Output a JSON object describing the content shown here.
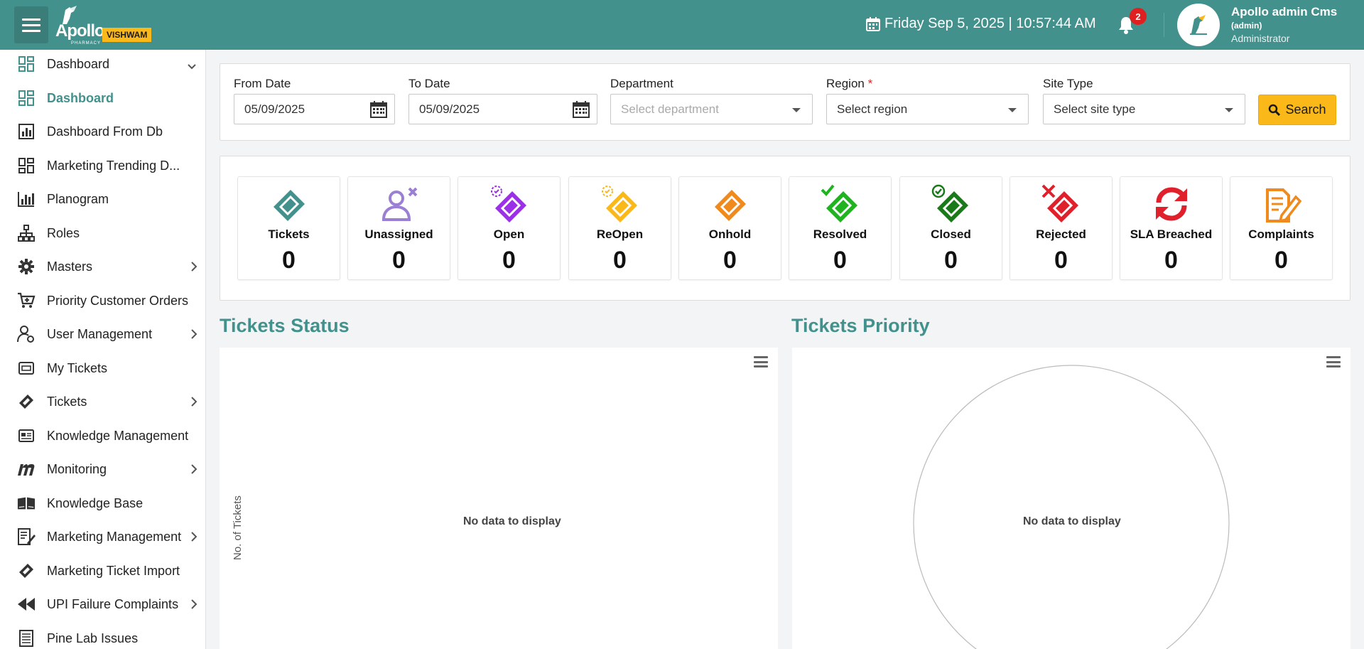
{
  "header": {
    "brand": "Apollo",
    "brand_sub": "PHARMACY",
    "badge": "VISHWAM",
    "datetime": "Friday Sep 5, 2025 | 10:57:44  AM",
    "notification_count": "2",
    "user": {
      "name": "Apollo admin Cms",
      "handle": "(admin)",
      "role": "Administrator"
    }
  },
  "sidebar": {
    "items": [
      {
        "label": "Dashboard",
        "icon": "grid-icon",
        "expand": "down"
      },
      {
        "label": "Dashboard",
        "icon": "grid-icon",
        "active": true
      },
      {
        "label": "Dashboard From Db",
        "icon": "bar-chart-icon"
      },
      {
        "label": "Marketing Trending D...",
        "icon": "grid-icon"
      },
      {
        "label": "Planogram",
        "icon": "analytics-icon"
      },
      {
        "label": "Roles",
        "icon": "hierarchy-icon"
      },
      {
        "label": "Masters",
        "icon": "gear-icon",
        "expand": "right"
      },
      {
        "label": "Priority Customer Orders",
        "icon": "cart-icon"
      },
      {
        "label": "User Management",
        "icon": "user-gear-icon",
        "expand": "right"
      },
      {
        "label": "My Tickets",
        "icon": "ticket-box-icon"
      },
      {
        "label": "Tickets",
        "icon": "ticket-icon",
        "expand": "right"
      },
      {
        "label": "Knowledge Management",
        "icon": "newspaper-icon"
      },
      {
        "label": "Monitoring",
        "icon": "m-logo-icon",
        "expand": "right"
      },
      {
        "label": "Knowledge Base",
        "icon": "book-icon"
      },
      {
        "label": "Marketing Management",
        "icon": "edit-doc-icon",
        "expand": "right"
      },
      {
        "label": "Marketing Ticket Import",
        "icon": "ticket-icon"
      },
      {
        "label": "UPI Failure Complaints",
        "icon": "rewind-icon",
        "expand": "right"
      },
      {
        "label": "Pine Lab Issues",
        "icon": "list-doc-icon"
      }
    ]
  },
  "filters": {
    "from_date": {
      "label": "From Date",
      "value": "05/09/2025"
    },
    "to_date": {
      "label": "To Date",
      "value": "05/09/2025"
    },
    "department": {
      "label": "Department",
      "placeholder": "Select department"
    },
    "region": {
      "label": "Region",
      "required_mark": "*",
      "value": "Select region"
    },
    "site_type": {
      "label": "Site Type",
      "value": "Select site type"
    },
    "search_label": "Search"
  },
  "stats": [
    {
      "label": "Tickets",
      "value": "0",
      "color": "#43918c",
      "icon": "ticket-icon"
    },
    {
      "label": "Unassigned",
      "value": "0",
      "color": "#9b7fd4",
      "icon": "user-x-icon"
    },
    {
      "label": "Open",
      "value": "0",
      "color": "#9b30e8",
      "icon": "ticket-open-icon"
    },
    {
      "label": "ReOpen",
      "value": "0",
      "color": "#fbb819",
      "icon": "ticket-reopen-icon"
    },
    {
      "label": "Onhold",
      "value": "0",
      "color": "#f08a1c",
      "icon": "ticket-hold-icon"
    },
    {
      "label": "Resolved",
      "value": "0",
      "color": "#1fb31f",
      "icon": "ticket-check-icon"
    },
    {
      "label": "Closed",
      "value": "0",
      "color": "#1a7a1a",
      "icon": "ticket-closed-icon"
    },
    {
      "label": "Rejected",
      "value": "0",
      "color": "#e0202a",
      "icon": "ticket-reject-icon"
    },
    {
      "label": "SLA Breached",
      "value": "0",
      "color": "#e0202a",
      "icon": "refresh-icon"
    },
    {
      "label": "Complaints",
      "value": "0",
      "color": "#f08a1c",
      "icon": "document-edit-icon"
    }
  ],
  "charts": {
    "status": {
      "title": "Tickets Status",
      "ylabel": "No. of Tickets",
      "empty_text": "No data to display"
    },
    "priority": {
      "title": "Tickets Priority",
      "empty_text": "No data to display"
    }
  }
}
